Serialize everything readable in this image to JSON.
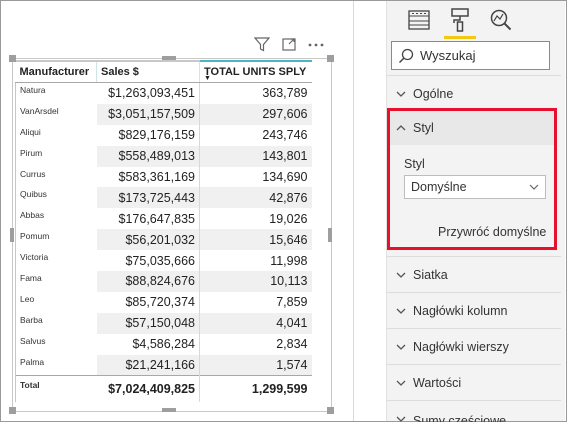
{
  "table": {
    "headers": [
      "Manufacturer",
      "Sales $",
      "TOTAL UNITS SPLY"
    ],
    "sort_indicator": "▼",
    "rows": [
      [
        "Natura",
        "$1,263,093,451",
        "363,789"
      ],
      [
        "VanArsdel",
        "$3,051,157,509",
        "297,606"
      ],
      [
        "Aliqui",
        "$829,176,159",
        "243,746"
      ],
      [
        "Pirum",
        "$558,489,013",
        "143,801"
      ],
      [
        "Currus",
        "$583,361,169",
        "134,690"
      ],
      [
        "Quibus",
        "$173,725,443",
        "42,876"
      ],
      [
        "Abbas",
        "$176,647,835",
        "19,026"
      ],
      [
        "Pomum",
        "$56,201,032",
        "15,646"
      ],
      [
        "Victoria",
        "$75,035,666",
        "11,998"
      ],
      [
        "Fama",
        "$88,824,676",
        "10,113"
      ],
      [
        "Leo",
        "$85,720,374",
        "7,859"
      ],
      [
        "Barba",
        "$57,150,048",
        "4,041"
      ],
      [
        "Salvus",
        "$4,586,284",
        "2,834"
      ],
      [
        "Palma",
        "$21,241,166",
        "1,574"
      ]
    ],
    "total": [
      "Total",
      "$7,024,409,825",
      "1,299,599"
    ]
  },
  "visual_header": {
    "icons": [
      "filter-icon",
      "focus-mode-icon",
      "more-options-icon"
    ]
  },
  "pane": {
    "tabs": [
      {
        "icon": "fields-icon",
        "active": false
      },
      {
        "icon": "format-paint-roller-icon",
        "active": true
      },
      {
        "icon": "analytics-icon",
        "active": false
      }
    ],
    "search_placeholder": "Wyszukaj",
    "sections_top": [
      "Ogólne"
    ],
    "styl": {
      "header": "Styl",
      "field_label": "Styl",
      "dropdown_value": "Domyślne",
      "reset_label": "Przywróć domyślne"
    },
    "sections_bottom": [
      "Siatka",
      "Nagłówki kolumn",
      "Nagłówki wierszy",
      "Wartości",
      "Sumy częściowe"
    ]
  },
  "colors": {
    "highlight_border": "#e8112d",
    "active_tab": "#f2c811",
    "header_accent": "#4cb5c8"
  }
}
